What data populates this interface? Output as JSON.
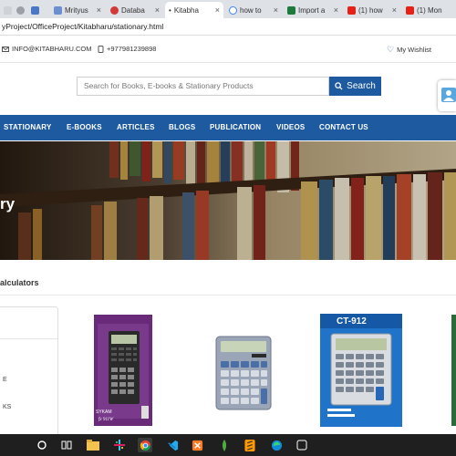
{
  "browser": {
    "tabs": [
      {
        "label": ""
      },
      {
        "label": ""
      },
      {
        "label": "Mrityus"
      },
      {
        "label": "Databa"
      },
      {
        "label": "Kitabha"
      },
      {
        "label": "how to"
      },
      {
        "label": "Import a"
      },
      {
        "label": "(1) how"
      },
      {
        "label": "(1) Mon"
      }
    ],
    "address": "yProject/OfficeProject/Kitabharu/stationary.html"
  },
  "infobar": {
    "email": "INFO@KITABHARU.COM",
    "phone": "+977981239898",
    "wishlist": "My Wishlist"
  },
  "search": {
    "placeholder": "Search for Books, E-books & Stationary Products",
    "button": "Search"
  },
  "nav": {
    "items": [
      "STATIONARY",
      "E-BOOKS",
      "ARTICLES",
      "BLOGS",
      "PUBLICATION",
      "VIDEOS",
      "CONTACT US"
    ]
  },
  "banner": {
    "title": "ry"
  },
  "section": {
    "title": "alculators"
  },
  "sidebar": {
    "items": [
      "E",
      "KS"
    ]
  },
  "products": [
    {
      "brand": "SYKAM",
      "model": "fx 911W"
    },
    {
      "brand": "",
      "model": ""
    },
    {
      "brand": "CT-912",
      "model": ""
    }
  ],
  "colors": {
    "brand_blue": "#1e5aa0",
    "taskbar": "#1f1f1f"
  }
}
